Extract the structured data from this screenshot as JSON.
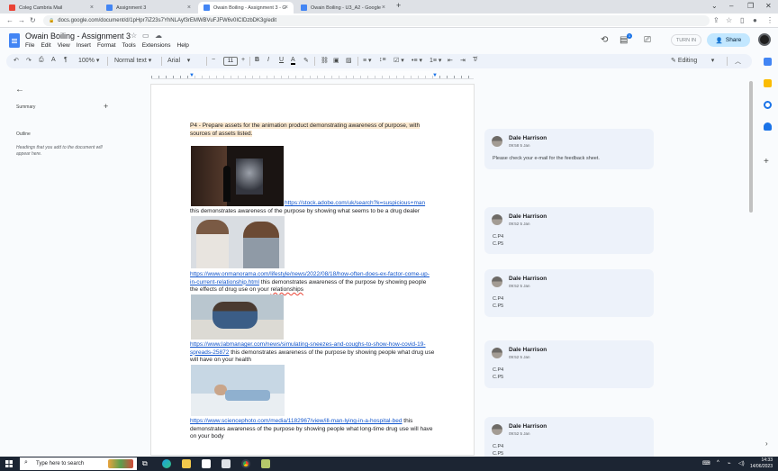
{
  "browser": {
    "tabs": [
      {
        "label": "Coleg Cambria Mail",
        "favicon_color": "#ea4335",
        "active": false
      },
      {
        "label": "Assignment 3",
        "favicon_color": "#4285f4",
        "active": false
      },
      {
        "label": "Owain Boiling - Assignment 3 - G",
        "favicon_color": "#4285f4",
        "active": true
      },
      {
        "label": "Owain Boiling - U3_A2 - Google",
        "favicon_color": "#4285f4",
        "active": false
      }
    ],
    "new_tab": "+",
    "url": "docs.google.com/document/d/1pHpr7iZ23s7YhNLAyf3rEMWBVuFJFW6v0ICIDzbDK3g/edit"
  },
  "docs": {
    "title": "Owain Boiling - Assignment 3",
    "menu": [
      "File",
      "Edit",
      "View",
      "Insert",
      "Format",
      "Tools",
      "Extensions",
      "Help"
    ],
    "turn_in_label": "TURN IN",
    "share_label": "Share",
    "notification_count": "1"
  },
  "toolbar": {
    "zoom": "100%",
    "style": "Normal text",
    "font": "Arial",
    "font_size": "11",
    "mode": "Editing"
  },
  "outline": {
    "summary_label": "Summary",
    "outline_label": "Outline",
    "hint": "Headings that you add to the document will appear here."
  },
  "document": {
    "heading": "P4 - Prepare assets for the animation product demonstrating awareness of purpose, with sources of assets listed.",
    "items": [
      {
        "link": "https://stock.adobe.com/uk/search?k=suspicious+man",
        "text": "this demonstrates awareness of the purpose by showing what seems to be a drug dealer"
      },
      {
        "link": "https://www.onmanorama.com/lifestyle/news/2022/08/18/how-often-does-ex-factor-come-up-in-current-relationship.html",
        "text": "this demonstrates awareness of the purpose by showing people the effects of drug use on your",
        "text_tail": "relationships"
      },
      {
        "link": "https://www.labmanager.com/news/simulating-sneezes-and-coughs-to-show-how-covid-19-spreads-25872",
        "text": "this demonstrates awareness of the purpose by showing people what drug use will have on your health"
      },
      {
        "link": "https://www.sciencephoto.com/media/1182967/view/ill-man-lying-in-a-hospital-bed",
        "text": "this demonstrates awareness of the purpose by showing people what long-time drug use will have on your body"
      }
    ]
  },
  "comments": [
    {
      "author": "Dale Harrison",
      "time": "09:58 5 Jan",
      "lines": [
        "Please check your e-mail for the feedback sheet."
      ]
    },
    {
      "author": "Dale Harrison",
      "time": "09:52 5 Jan",
      "lines": [
        "C.P4",
        "C.P5"
      ]
    },
    {
      "author": "Dale Harrison",
      "time": "09:52 5 Jan",
      "lines": [
        "C.P4",
        "C.P5"
      ]
    },
    {
      "author": "Dale Harrison",
      "time": "09:52 5 Jan",
      "lines": [
        "C.P4",
        "C.P5"
      ]
    },
    {
      "author": "Dale Harrison",
      "time": "09:52 5 Jan",
      "lines": [
        "C.P4",
        "C.P5"
      ]
    }
  ],
  "taskbar": {
    "search_placeholder": "Type here to search",
    "time": "14:33",
    "date": "14/06/2023"
  }
}
